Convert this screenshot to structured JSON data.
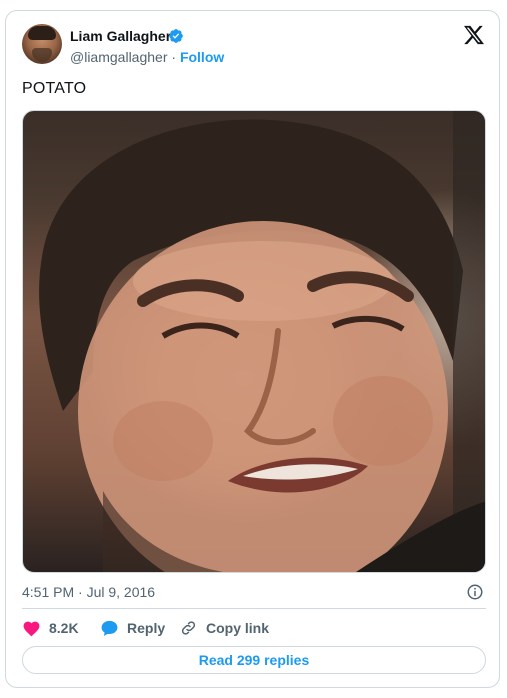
{
  "author": {
    "display_name": "Liam Gallagher",
    "handle": "@liamgallagher",
    "separator": " · ",
    "follow_label": "Follow",
    "verified_color": "#1d9bf0"
  },
  "tweet": {
    "text": "POTATO",
    "timestamp": "4:51 PM · Jul 9, 2016"
  },
  "actions": {
    "like_count": "8.2K",
    "reply_label": "Reply",
    "copy_link_label": "Copy link",
    "read_replies_label": "Read 299 replies"
  },
  "icons": {
    "platform_logo": "x-logo-icon",
    "verified": "verified-badge-icon",
    "info": "info-icon",
    "like": "heart-icon",
    "reply": "speech-bubble-icon",
    "copy_link": "link-icon"
  },
  "colors": {
    "accent": "#1d9bf0",
    "like": "#f91880",
    "secondary_text": "#536471",
    "border": "#cfd9de"
  }
}
